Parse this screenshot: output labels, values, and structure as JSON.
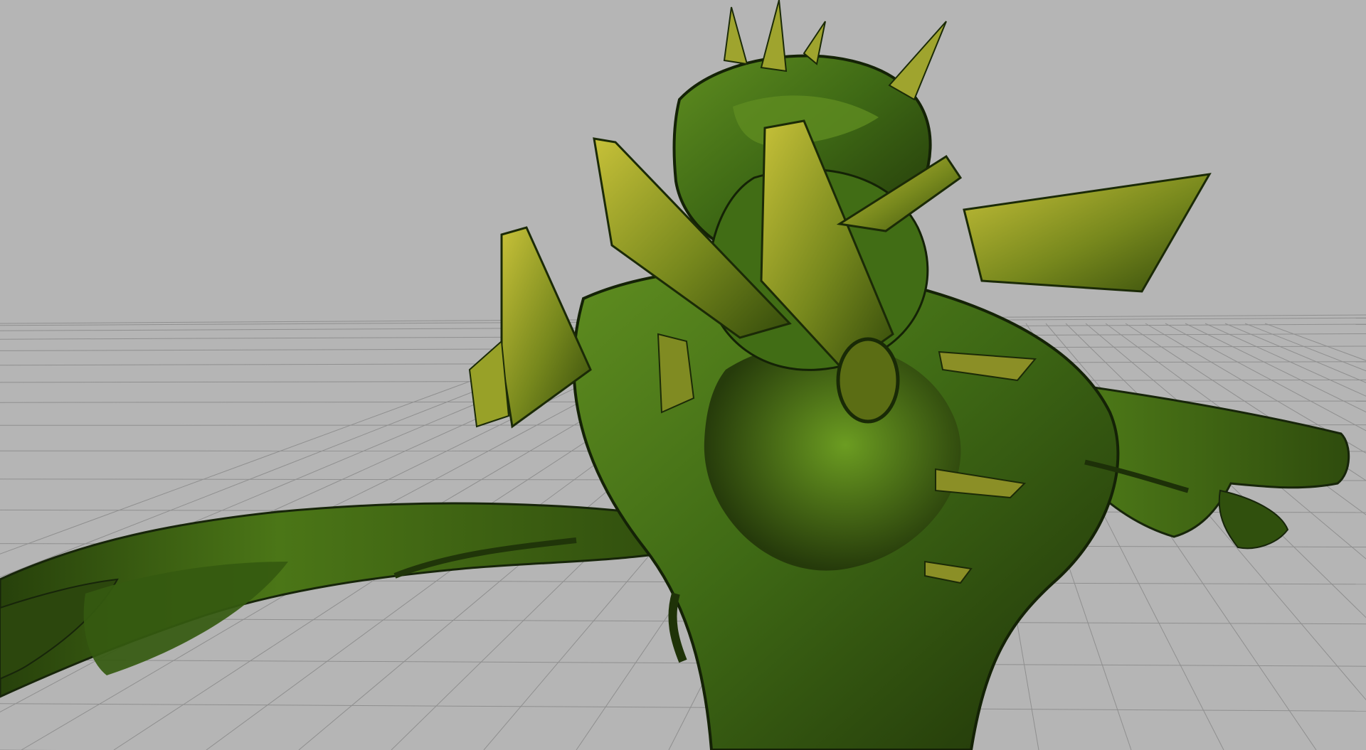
{
  "viewport": {
    "background_color": "#b5b5b5",
    "grid_line_color": "#8f8f8f",
    "grid_visible": true,
    "model": {
      "kind": "spiky-tree-creature",
      "primary_color": "#3f6a15",
      "highlight_color": "#7ba822",
      "shadow_color": "#1f3208",
      "spike_color": "#a7aa2a"
    }
  }
}
